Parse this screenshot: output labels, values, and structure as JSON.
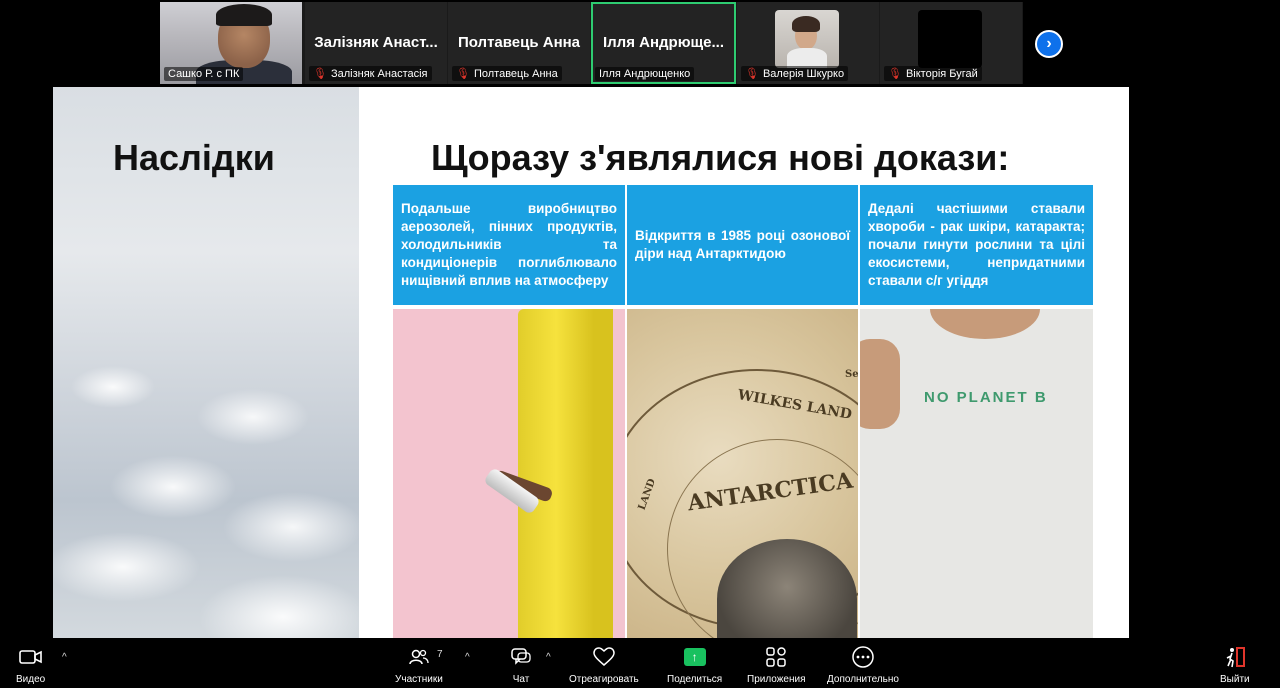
{
  "participants": {
    "tiles": [
      {
        "name": "Сашко Р. с ПК",
        "big_name": ""
      },
      {
        "name": "Залізняк Анастасія",
        "big_name": "Залізняк Анаст..."
      },
      {
        "name": "Полтавець Анна",
        "big_name": "Полтавець Анна"
      },
      {
        "name": "Ілля Андрющенко",
        "big_name": "Ілля Андрюще..."
      },
      {
        "name": "Валерія Шкурко",
        "big_name": ""
      },
      {
        "name": "Вікторія Бугай",
        "big_name": ""
      }
    ],
    "next_icon": "chevron-right-icon"
  },
  "slide": {
    "left_title": "Наслідки",
    "title": "Щоразу з'являлися нові докази:",
    "cells": [
      "Подальше виробництво аерозолей, пінних продуктів, холодильників та кондиціонерів поглиблювало нищівний вплив на атмосферу",
      "Відкриття в 1985 році озонової діри над Антарктидою",
      "Дедалі частішими ставали хвороби - рак шкіри, катаракта; почали гинути рослини та цілі екосистеми, непридатними ставали с/г угіддя"
    ],
    "images": {
      "globe_wilkes": "WILKES LAND",
      "globe_antarctica": "ANTARCTICA",
      "globe_land": "LAND",
      "globe_se": "Se",
      "shirt_text": "NO PLANET  B"
    }
  },
  "toolbar": {
    "video": "Видео",
    "participants": "Участники",
    "participants_count": "7",
    "chat": "Чат",
    "react": "Отреагировать",
    "share": "Поделиться",
    "apps": "Приложения",
    "more": "Дополнительно",
    "leave": "Выйти"
  },
  "colors": {
    "accent_blue": "#1ba1e2",
    "share_green": "#19c15f",
    "active_speaker": "#2ecc71",
    "muted_red": "#e0352b"
  }
}
